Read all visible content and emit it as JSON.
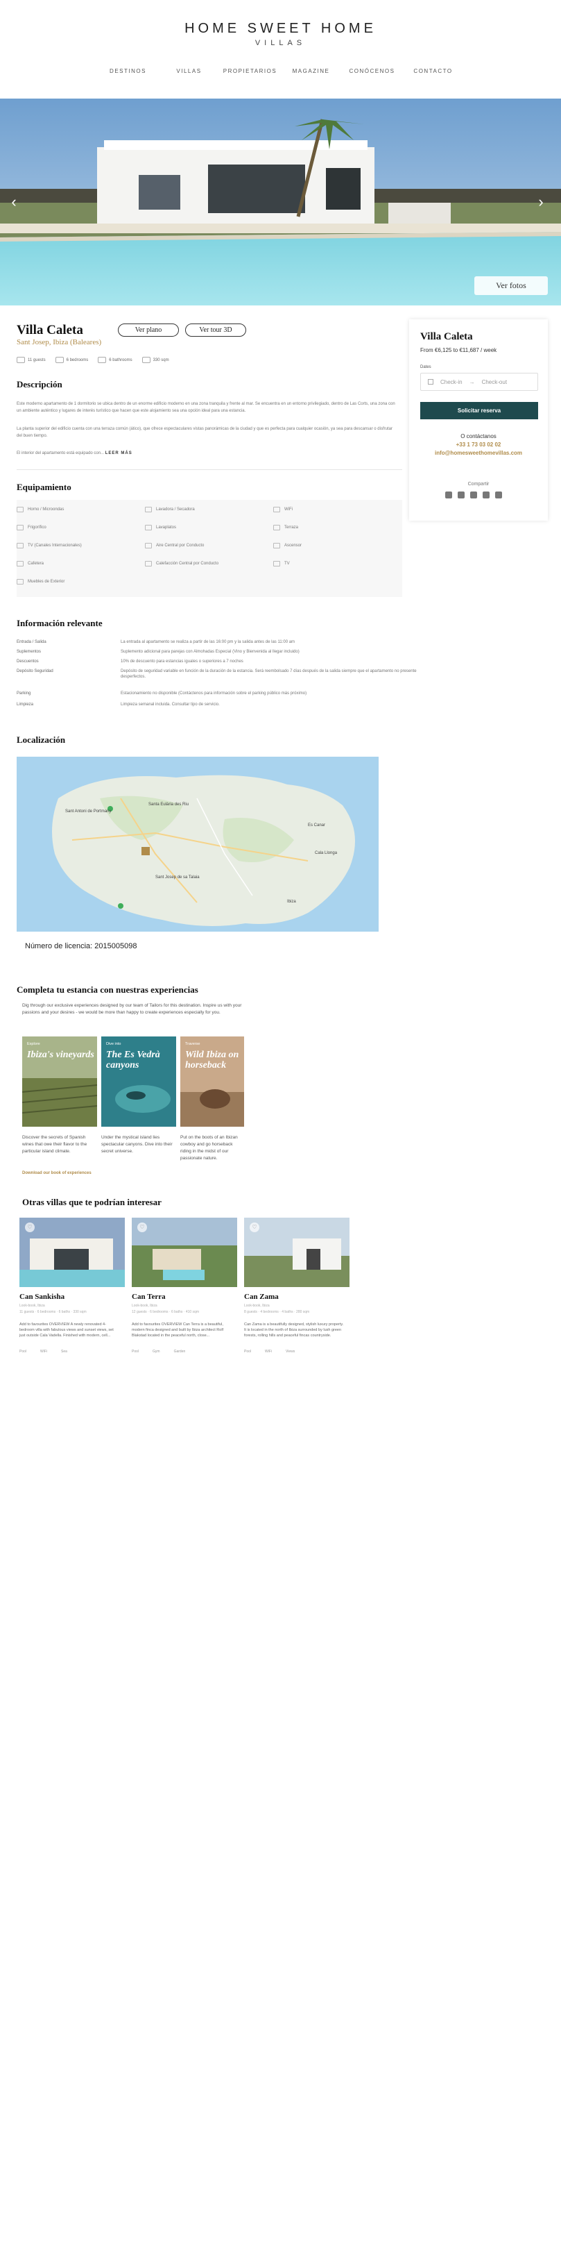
{
  "header": {
    "brand": "HOME SWEET HOME",
    "sub": "VILLAS",
    "nav": [
      "DESTINOS",
      "VILLAS",
      "PROPIETARIOS",
      "MAGAZINE",
      "CONÓCENOS",
      "CONTACTO"
    ]
  },
  "hero": {
    "prev": "‹",
    "next": "›",
    "photos_button": "Ver fotos"
  },
  "villa": {
    "title": "Villa Caleta",
    "location": "Sant Josep, Ibiza (Baleares)",
    "buttons": {
      "plan": "Ver plano",
      "tour": "Ver tour 3D"
    },
    "facts": [
      "11 guests",
      "6 bedrooms",
      "6 bathrooms",
      "330 sqm"
    ]
  },
  "description": {
    "heading": "Descripción",
    "p1": "Este moderno apartamento de 1 dormitorio se ubica dentro de un enorme edificio moderno en una zona tranquila y frente al mar. Se encuentra en un entorno privilegiado, dentro de Las Corts, una zona con un ambiente auténtico y lugares de interés turístico que hacen que este alojamiento sea una opción ideal para una estancia.",
    "p2": "La planta superior del edificio cuenta con una terraza común (ático), que ofrece espectaculares vistas panorámicas de la ciudad y que es perfecta para cualquier ocasión, ya sea para descansar o disfrutar del buen tiempo.",
    "p3": "El interior del apartamento está equipado con...",
    "read_more": "LEER MÁS"
  },
  "equipment": {
    "heading": "Equipamiento",
    "items": [
      "Horno / Microondas",
      "Lavadora / Secadora",
      "WiFi",
      "Frigorífico",
      "Lavaplatos",
      "Terraza",
      "TV (Canales Internacionales)",
      "Aire Central por Conducto",
      "Ascensor",
      "Cafetera",
      "Calefacción Central por Conducto",
      "TV",
      "Muebles de Exterior"
    ]
  },
  "info": {
    "heading": "Información relevante",
    "rows": [
      {
        "k": "Entrada / Salida",
        "v": "La entrada al apartamento se realiza a partir de las 16:00 pm y la salida antes de las 11:00 am"
      },
      {
        "k": "Suplementos",
        "v": "Suplemento adicional para parejas con Almohadas Especial (Vino y Bienvenida al llegar incluido)"
      },
      {
        "k": "Descuentos",
        "v": "10% de descuento para estancias iguales o superiores a 7 noches"
      },
      {
        "k": "Depósito Seguridad",
        "v": "Depósito de seguridad variable en función de la duración de la estancia. Será reembolsado 7 días después de la salida siempre que el apartamento no presente desperfectos."
      },
      {
        "k": "Parking",
        "v": "Estacionamiento no disponible (Contáctenos para información sobre el parking público más próximo)"
      },
      {
        "k": "Limpieza",
        "v": "Limpieza semanal incluida. Consultar tipo de servicio."
      }
    ]
  },
  "location": {
    "heading": "Localización",
    "licence": "Número de licencia: 2015005098",
    "map_labels": [
      "Santa Eulària des Riu",
      "Sant Antoni de Portmany",
      "Ibiza",
      "Sant Josep de sa Talaia",
      "Es Canar",
      "Cala Llonga"
    ]
  },
  "experiences": {
    "heading": "Completa tu estancia con nuestras experiencias",
    "intro": "Dig through our exclusive experiences designed by our team of Tailors for this destination. Inspire us with your passions and your desires - we would be more than happy to create experiences especially for you.",
    "cards": [
      {
        "label": "Explore",
        "title": "Ibiza's vineyards",
        "desc": "Discover the secrets of Spanish wines that owe their flavor to the particular island climate."
      },
      {
        "label": "Dive into",
        "title": "The Es Vedrà canyons",
        "desc": "Under the mystical island lies spectacular canyons. Dive into their secret universe."
      },
      {
        "label": "Traverse",
        "title": "Wild Ibiza on horseback",
        "desc": "Put on the boots of an Ibizan cowboy and go horseback riding in the midst of our passionate nature."
      }
    ],
    "link": "Download our book of experiences"
  },
  "others": {
    "heading": "Otras villas que te podrían interesar",
    "villas": [
      {
        "name": "Can Sankisha",
        "meta1": "Look-book, Ibiza",
        "meta2": "11 guests · 6 bedrooms · 6 baths · 330 sqm",
        "desc": "Add to favourites OVERVIEW A newly renovated 4-bedroom villa with fabulous views and sunset views, set just outside Cala Vadella. Finished with modern, cell...",
        "stats": [
          "Pool",
          "WiFi",
          "Sea"
        ]
      },
      {
        "name": "Can Terra",
        "meta1": "Look-book, Ibiza",
        "meta2": "12 guests · 6 bedrooms · 6 baths · 410 sqm",
        "desc": "Add to favourites OVERVIEW Can Terra is a beautiful, modern finca designed and built by Ibiza architect Rolf Blakstad located in the peaceful north, close...",
        "stats": [
          "Pool",
          "Gym",
          "Garden"
        ]
      },
      {
        "name": "Can Zama",
        "meta1": "Look-book, Ibiza",
        "meta2": "8 guests · 4 bedrooms · 4 baths · 280 sqm",
        "desc": "Can Zama is a beautifully designed, stylish luxury property. It is located in the north of Ibiza surrounded by lush green forests, rolling hills and peaceful fincas countryside.",
        "stats": [
          "Pool",
          "WiFi",
          "Views"
        ]
      }
    ]
  },
  "booking": {
    "title": "Villa Caleta",
    "price": "From €6,125 to €11,687 / week",
    "dates_label": "Dates",
    "checkin": "Check-in",
    "checkout": "Check-out",
    "button": "Solicitar reserva",
    "contact_text": "O contáctanos",
    "phone": "+33 1 73 03 02 02",
    "email": "info@homesweethomevillas.com",
    "share": "Compartir"
  },
  "colors": {
    "accent": "#b08c4a",
    "button": "#1e4a4e"
  }
}
